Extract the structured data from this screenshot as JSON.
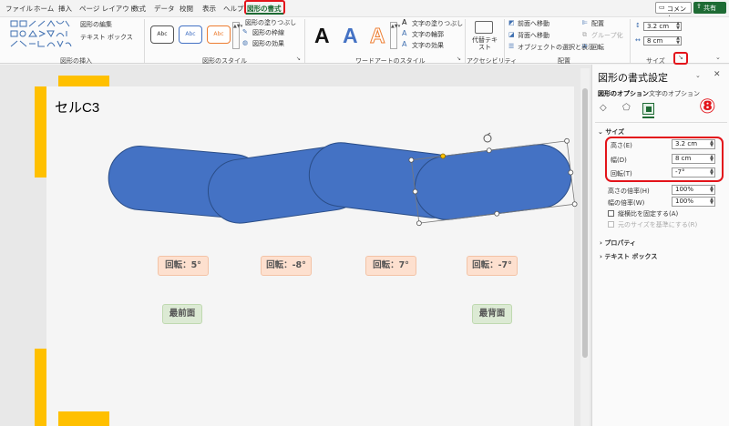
{
  "menu": {
    "tabs": [
      "ファイル",
      "ホーム",
      "挿入",
      "ページ レイアウト",
      "数式",
      "データ",
      "校閲",
      "表示",
      "ヘルプ",
      "図形の書式"
    ],
    "active_tab": "図形の書式",
    "comment_label": "コメント",
    "share_label": "共有"
  },
  "ribbon": {
    "insert_shapes": {
      "edit_shape": "図形の編集",
      "text_box": "テキスト ボックス",
      "label": "図形の挿入"
    },
    "shape_styles": {
      "preset": "Abc",
      "fill": "図形の塗りつぶし",
      "outline": "図形の枠線",
      "effects": "図形の効果",
      "label": "図形のスタイル"
    },
    "wordart": {
      "letter": "A",
      "text_fill": "文字の塗りつぶし",
      "text_outline": "文字の輪郭",
      "text_effects": "文字の効果",
      "label": "ワードアートのスタイル"
    },
    "accessibility": {
      "alt_text": "代替テキスト",
      "label": "アクセシビリティ"
    },
    "arrange": {
      "bring_forward": "前面へ移動",
      "send_backward": "背面へ移動",
      "selection_pane": "オブジェクトの選択と表示",
      "align": "配置",
      "group": "グループ化",
      "rotate": "回転",
      "label": "配置"
    },
    "size": {
      "height": "3.2 cm",
      "width": "8 cm",
      "label": "サイズ"
    }
  },
  "slide": {
    "title": "セルC3",
    "rotation_labels": [
      "回転：5°",
      "回転：-8°",
      "回転：7°",
      "回転：-7°"
    ],
    "front_label": "最前面",
    "back_label": "最背面"
  },
  "pane": {
    "title": "図形の書式設定",
    "tab_shape": "図形のオプション",
    "tab_text": "文字のオプション",
    "step_number": "⑧",
    "section_size": "サイズ",
    "height_label": "高さ(E)",
    "height_value": "3.2 cm",
    "width_label": "幅(D)",
    "width_value": "8 cm",
    "rotation_label": "回転(T)",
    "rotation_value": "-7°",
    "scale_h_label": "高さの倍率(H)",
    "scale_h_value": "100%",
    "scale_w_label": "幅の倍率(W)",
    "scale_w_value": "100%",
    "lock_aspect": "縦横比を固定する(A)",
    "relative_original": "元のサイズを基準にする(R)",
    "section_properties": "プロパティ",
    "section_textbox": "テキスト ボックス"
  },
  "colors": {
    "accent_green": "#1e6b34",
    "shape_blue": "#4472c4",
    "highlight_red": "#e3141b",
    "slide_yellow": "#ffc000"
  }
}
